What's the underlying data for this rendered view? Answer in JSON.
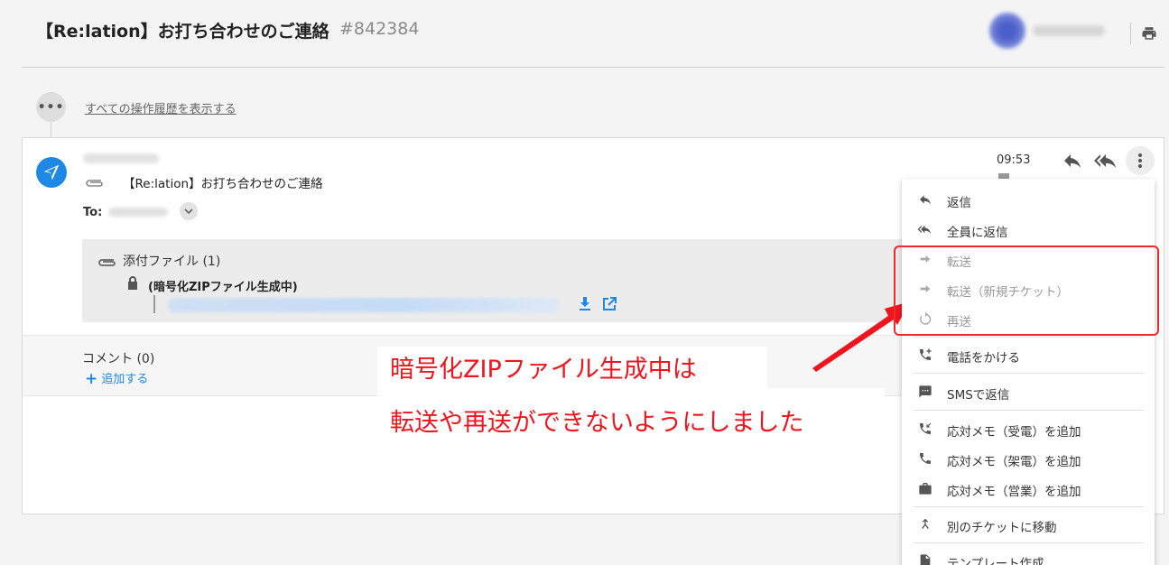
{
  "header": {
    "title": "【Re:lation】お打ち合わせのご連絡",
    "ticket_number": "#842384"
  },
  "history": {
    "more_label": "•••",
    "show_all_link": "すべての操作履歴を表示する"
  },
  "message": {
    "subject": "【Re:lation】お打ち合わせのご連絡",
    "to_label": "To:",
    "time": "09:53"
  },
  "attachment": {
    "title": "添付ファイル (1)",
    "status": "(暗号化ZIPファイル生成中)"
  },
  "comments": {
    "label": "コメント (0)",
    "add_label": "追加する"
  },
  "annotation": {
    "line1": "暗号化ZIPファイル生成中は",
    "line2": "転送や再送ができないようにしました"
  },
  "menu": {
    "items": [
      {
        "label": "返信",
        "icon": "reply-icon",
        "enabled": true
      },
      {
        "label": "全員に返信",
        "icon": "reply-all-icon",
        "enabled": true
      },
      {
        "label": "転送",
        "icon": "forward-icon",
        "enabled": false
      },
      {
        "label": "転送（新規チケット）",
        "icon": "forward-icon",
        "enabled": false
      },
      {
        "label": "再送",
        "icon": "resend-icon",
        "enabled": false
      },
      {
        "label": "電話をかける",
        "icon": "phone-call-icon",
        "enabled": true
      },
      {
        "label": "SMSで返信",
        "icon": "sms-icon",
        "enabled": true
      },
      {
        "label": "応対メモ（受電）を追加",
        "icon": "incoming-call-icon",
        "enabled": true
      },
      {
        "label": "応対メモ（架電）を追加",
        "icon": "phone-icon",
        "enabled": true
      },
      {
        "label": "応対メモ（営業）を追加",
        "icon": "briefcase-icon",
        "enabled": true
      },
      {
        "label": "別のチケットに移動",
        "icon": "move-icon",
        "enabled": true
      },
      {
        "label": "テンプレート作成",
        "icon": "template-icon",
        "enabled": true
      }
    ]
  },
  "colors": {
    "accent": "#1e88e5",
    "annotation_red": "#f0141e",
    "disabled_text": "#9a9a9a"
  }
}
